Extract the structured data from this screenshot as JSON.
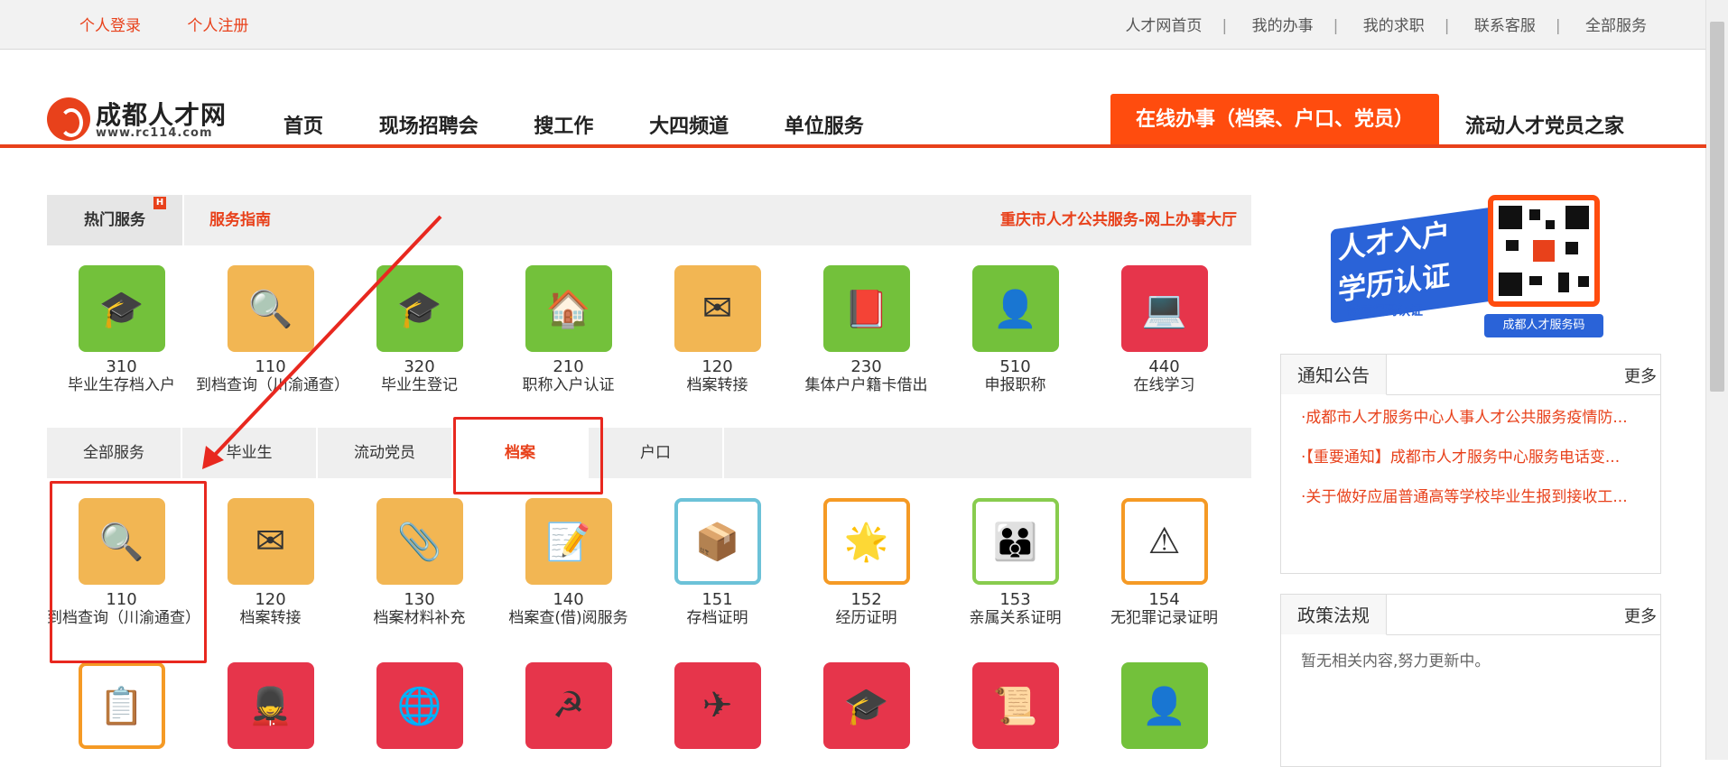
{
  "topbar": {
    "login": "个人登录",
    "register": "个人注册",
    "links": [
      "人才网首页",
      "我的办事",
      "我的求职",
      "联系客服",
      "全部服务"
    ],
    "separator": "|"
  },
  "logo": {
    "name": "成都人才网",
    "url": "www.rc114.com"
  },
  "nav": {
    "items": [
      "首页",
      "现场招聘会",
      "搜工作",
      "大四频道",
      "单位服务"
    ],
    "active": "在线办事（档案、户口、党员）",
    "party": "流动人才党员之家"
  },
  "hot_tabs": {
    "hot": "热门服务",
    "hot_badge": "H",
    "guide": "服务指南",
    "cq": "重庆市人才公共服务-网上办事大厅"
  },
  "hot_services": [
    {
      "num": "310",
      "label": "毕业生存档入户",
      "icon": "graduate-icon",
      "color": "#73c13b"
    },
    {
      "num": "110",
      "label": "到档查询（川渝通查）",
      "icon": "archive-search-icon",
      "color": "#f2b653"
    },
    {
      "num": "320",
      "label": "毕业生登记",
      "icon": "graduate-icon",
      "color": "#73c13b"
    },
    {
      "num": "210",
      "label": "职称入户认证",
      "icon": "certificate-house-icon",
      "color": "#73c13b"
    },
    {
      "num": "120",
      "label": "档案转接",
      "icon": "envelope-icon",
      "color": "#f2b653"
    },
    {
      "num": "230",
      "label": "集体户户籍卡借出",
      "icon": "red-book-icon",
      "color": "#73c13b"
    },
    {
      "num": "510",
      "label": "申报职称",
      "icon": "person-icon",
      "color": "#73c13b"
    },
    {
      "num": "440",
      "label": "在线学习",
      "icon": "online-learning-icon",
      "color": "#e6354b"
    }
  ],
  "category_tabs": [
    "全部服务",
    "毕业生",
    "流动党员",
    "档案",
    "户口"
  ],
  "category_selected": "档案",
  "archive_services": [
    {
      "num": "110",
      "label": "到档查询（川渝通查）",
      "icon": "archive-search-icon"
    },
    {
      "num": "120",
      "label": "档案转接",
      "icon": "envelope-icon"
    },
    {
      "num": "130",
      "label": "档案材料补充",
      "icon": "paperclip-plus-icon"
    },
    {
      "num": "140",
      "label": "档案查(借)阅服务",
      "icon": "document-pen-icon"
    },
    {
      "num": "151",
      "label": "存档证明",
      "icon": "archive-box-icon"
    },
    {
      "num": "152",
      "label": "经历证明",
      "icon": "experience-icon"
    },
    {
      "num": "153",
      "label": "亲属关系证明",
      "icon": "family-icon"
    },
    {
      "num": "154",
      "label": "无犯罪记录证明",
      "icon": "warning-folder-icon"
    }
  ],
  "third_row_icons": [
    "certificate-clipboard-icon",
    "soldier-icon",
    "globe-certificate-icon",
    "party-emblem-icon",
    "airplane-icon",
    "graduation-cap-icon",
    "political-review-icon",
    "person-icon"
  ],
  "qr_banner": {
    "title_line1": "人才入户",
    "title_line2": "学历认证",
    "subtitle": "微信扫码认证",
    "code_caption": "成都人才服务码"
  },
  "notice": {
    "title": "通知公告",
    "more": "更多",
    "items": [
      "·成都市人才服务中心人事人才公共服务疫情防...",
      "·【重要通知】成都市人才服务中心服务电话变...",
      "·关于做好应届普通高等学校毕业生报到接收工..."
    ]
  },
  "policy": {
    "title": "政策法规",
    "more": "更多",
    "empty": "暂无相关内容,努力更新中。"
  }
}
